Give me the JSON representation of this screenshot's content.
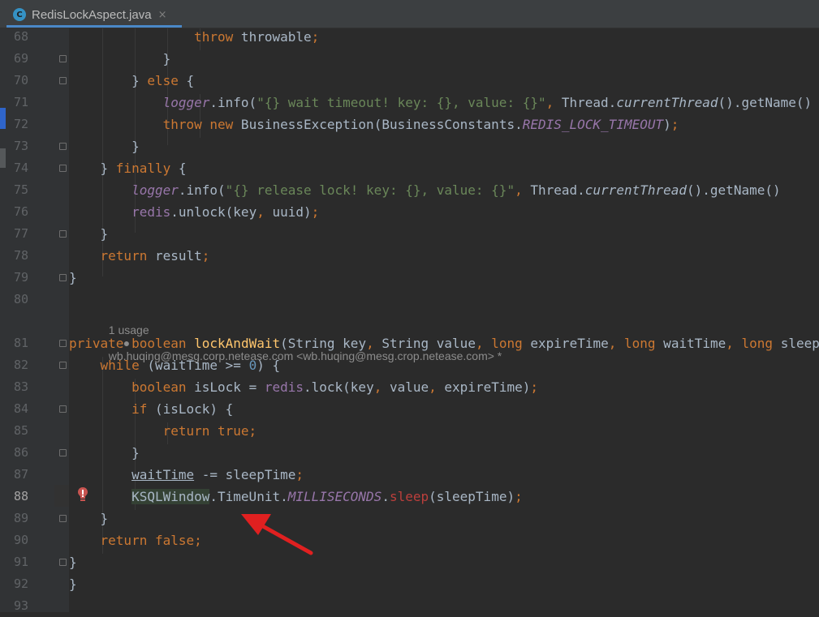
{
  "tab": {
    "icon": "C",
    "title": "RedisLockAspect.java",
    "close": "×"
  },
  "hint": {
    "usages": "1 usage",
    "author": "wb.huqing@mesg.corp.netease.com <wb.huqing@mesg.crop.netease.com> *"
  },
  "lines": [
    {
      "num": "68",
      "parts": [
        [
          "",
          "                "
        ],
        [
          "kw",
          "throw"
        ],
        [
          "",
          " throwable"
        ],
        [
          "kw",
          ";"
        ]
      ]
    },
    {
      "num": "69",
      "parts": [
        [
          "",
          "            }"
        ]
      ]
    },
    {
      "num": "70",
      "parts": [
        [
          "",
          "        } "
        ],
        [
          "kw",
          "else"
        ],
        [
          "",
          " {"
        ]
      ]
    },
    {
      "num": "71",
      "parts": [
        [
          "",
          "            "
        ],
        [
          "fi",
          "logger"
        ],
        [
          "",
          ".info("
        ],
        [
          "str",
          "\"{} wait timeout! key: {}, value: {}\""
        ],
        [
          "kw",
          ","
        ],
        [
          "",
          " Thread."
        ],
        [
          "mi",
          "currentThread"
        ],
        [
          "",
          "().getName()"
        ]
      ]
    },
    {
      "num": "72",
      "parts": [
        [
          "",
          "            "
        ],
        [
          "kw",
          "throw new"
        ],
        [
          "",
          " BusinessException(BusinessConstants."
        ],
        [
          "fi",
          "REDIS_LOCK_TIMEOUT"
        ],
        [
          "",
          ")"
        ],
        [
          "kw",
          ";"
        ]
      ]
    },
    {
      "num": "73",
      "parts": [
        [
          "",
          "        }"
        ]
      ]
    },
    {
      "num": "74",
      "parts": [
        [
          "",
          "    } "
        ],
        [
          "kw",
          "finally"
        ],
        [
          "",
          " {"
        ]
      ]
    },
    {
      "num": "75",
      "parts": [
        [
          "",
          "        "
        ],
        [
          "fi",
          "logger"
        ],
        [
          "",
          ".info("
        ],
        [
          "str",
          "\"{} release lock! key: {}, value: {}\""
        ],
        [
          "kw",
          ","
        ],
        [
          "",
          " Thread."
        ],
        [
          "mi",
          "currentThread"
        ],
        [
          "",
          "().getName()"
        ]
      ]
    },
    {
      "num": "76",
      "parts": [
        [
          "",
          "        "
        ],
        [
          "fld",
          "redis"
        ],
        [
          "",
          ".unlock(key"
        ],
        [
          "kw",
          ","
        ],
        [
          "",
          " uuid)"
        ],
        [
          "kw",
          ";"
        ]
      ]
    },
    {
      "num": "77",
      "parts": [
        [
          "",
          "    }"
        ]
      ]
    },
    {
      "num": "78",
      "parts": [
        [
          "",
          "    "
        ],
        [
          "kw",
          "return"
        ],
        [
          "",
          " result"
        ],
        [
          "kw",
          ";"
        ]
      ]
    },
    {
      "num": "79",
      "parts": [
        [
          "",
          "}"
        ]
      ]
    },
    {
      "num": "80",
      "parts": []
    },
    {
      "num": "81",
      "parts": [
        [
          "kw",
          "private boolean"
        ],
        [
          "",
          " "
        ],
        [
          "fn",
          "lockAndWait"
        ],
        [
          "",
          "(String key"
        ],
        [
          "kw",
          ","
        ],
        [
          "",
          " String value"
        ],
        [
          "kw",
          ","
        ],
        [
          "",
          " "
        ],
        [
          "kw",
          "long"
        ],
        [
          "",
          " expireTime"
        ],
        [
          "kw",
          ","
        ],
        [
          "",
          " "
        ],
        [
          "kw",
          "long"
        ],
        [
          "",
          " waitTime"
        ],
        [
          "kw",
          ","
        ],
        [
          "",
          " "
        ],
        [
          "kw",
          "long"
        ],
        [
          "",
          " sleepTime"
        ]
      ]
    },
    {
      "num": "82",
      "parts": [
        [
          "",
          "    "
        ],
        [
          "kw",
          "while"
        ],
        [
          "",
          " (waitTime >= "
        ],
        [
          "num",
          "0"
        ],
        [
          "",
          ") {"
        ]
      ]
    },
    {
      "num": "83",
      "parts": [
        [
          "",
          "        "
        ],
        [
          "kw",
          "boolean"
        ],
        [
          "",
          " isLock = "
        ],
        [
          "fld",
          "redis"
        ],
        [
          "",
          ".lock(key"
        ],
        [
          "kw",
          ","
        ],
        [
          "",
          " value"
        ],
        [
          "kw",
          ","
        ],
        [
          "",
          " expireTime)"
        ],
        [
          "kw",
          ";"
        ]
      ]
    },
    {
      "num": "84",
      "parts": [
        [
          "",
          "        "
        ],
        [
          "kw",
          "if"
        ],
        [
          "",
          " (isLock) {"
        ]
      ]
    },
    {
      "num": "85",
      "parts": [
        [
          "",
          "            "
        ],
        [
          "kw",
          "return true;"
        ]
      ]
    },
    {
      "num": "86",
      "parts": [
        [
          "",
          "        }"
        ]
      ]
    },
    {
      "num": "87",
      "parts": [
        [
          "",
          "        "
        ],
        [
          "ul",
          "waitTime"
        ],
        [
          "",
          " -= sleepTime"
        ],
        [
          "kw",
          ";"
        ]
      ]
    },
    {
      "num": "88",
      "parts": [
        [
          "",
          "        "
        ],
        [
          "hl",
          "KSQLWindow"
        ],
        [
          "",
          ".TimeUnit."
        ],
        [
          "fi",
          "MILLISECONDS"
        ],
        [
          "",
          "."
        ],
        [
          "err",
          "sleep"
        ],
        [
          "",
          "(sleepTime)"
        ],
        [
          "kw",
          ";"
        ]
      ]
    },
    {
      "num": "89",
      "parts": [
        [
          "",
          "    }"
        ]
      ]
    },
    {
      "num": "90",
      "parts": [
        [
          "",
          "    "
        ],
        [
          "kw",
          "return false;"
        ]
      ]
    },
    {
      "num": "91",
      "parts": [
        [
          "",
          "}"
        ]
      ]
    },
    {
      "num": "92",
      "parts": [
        [
          "",
          "}"
        ]
      ]
    },
    {
      "num": "93",
      "parts": []
    }
  ]
}
